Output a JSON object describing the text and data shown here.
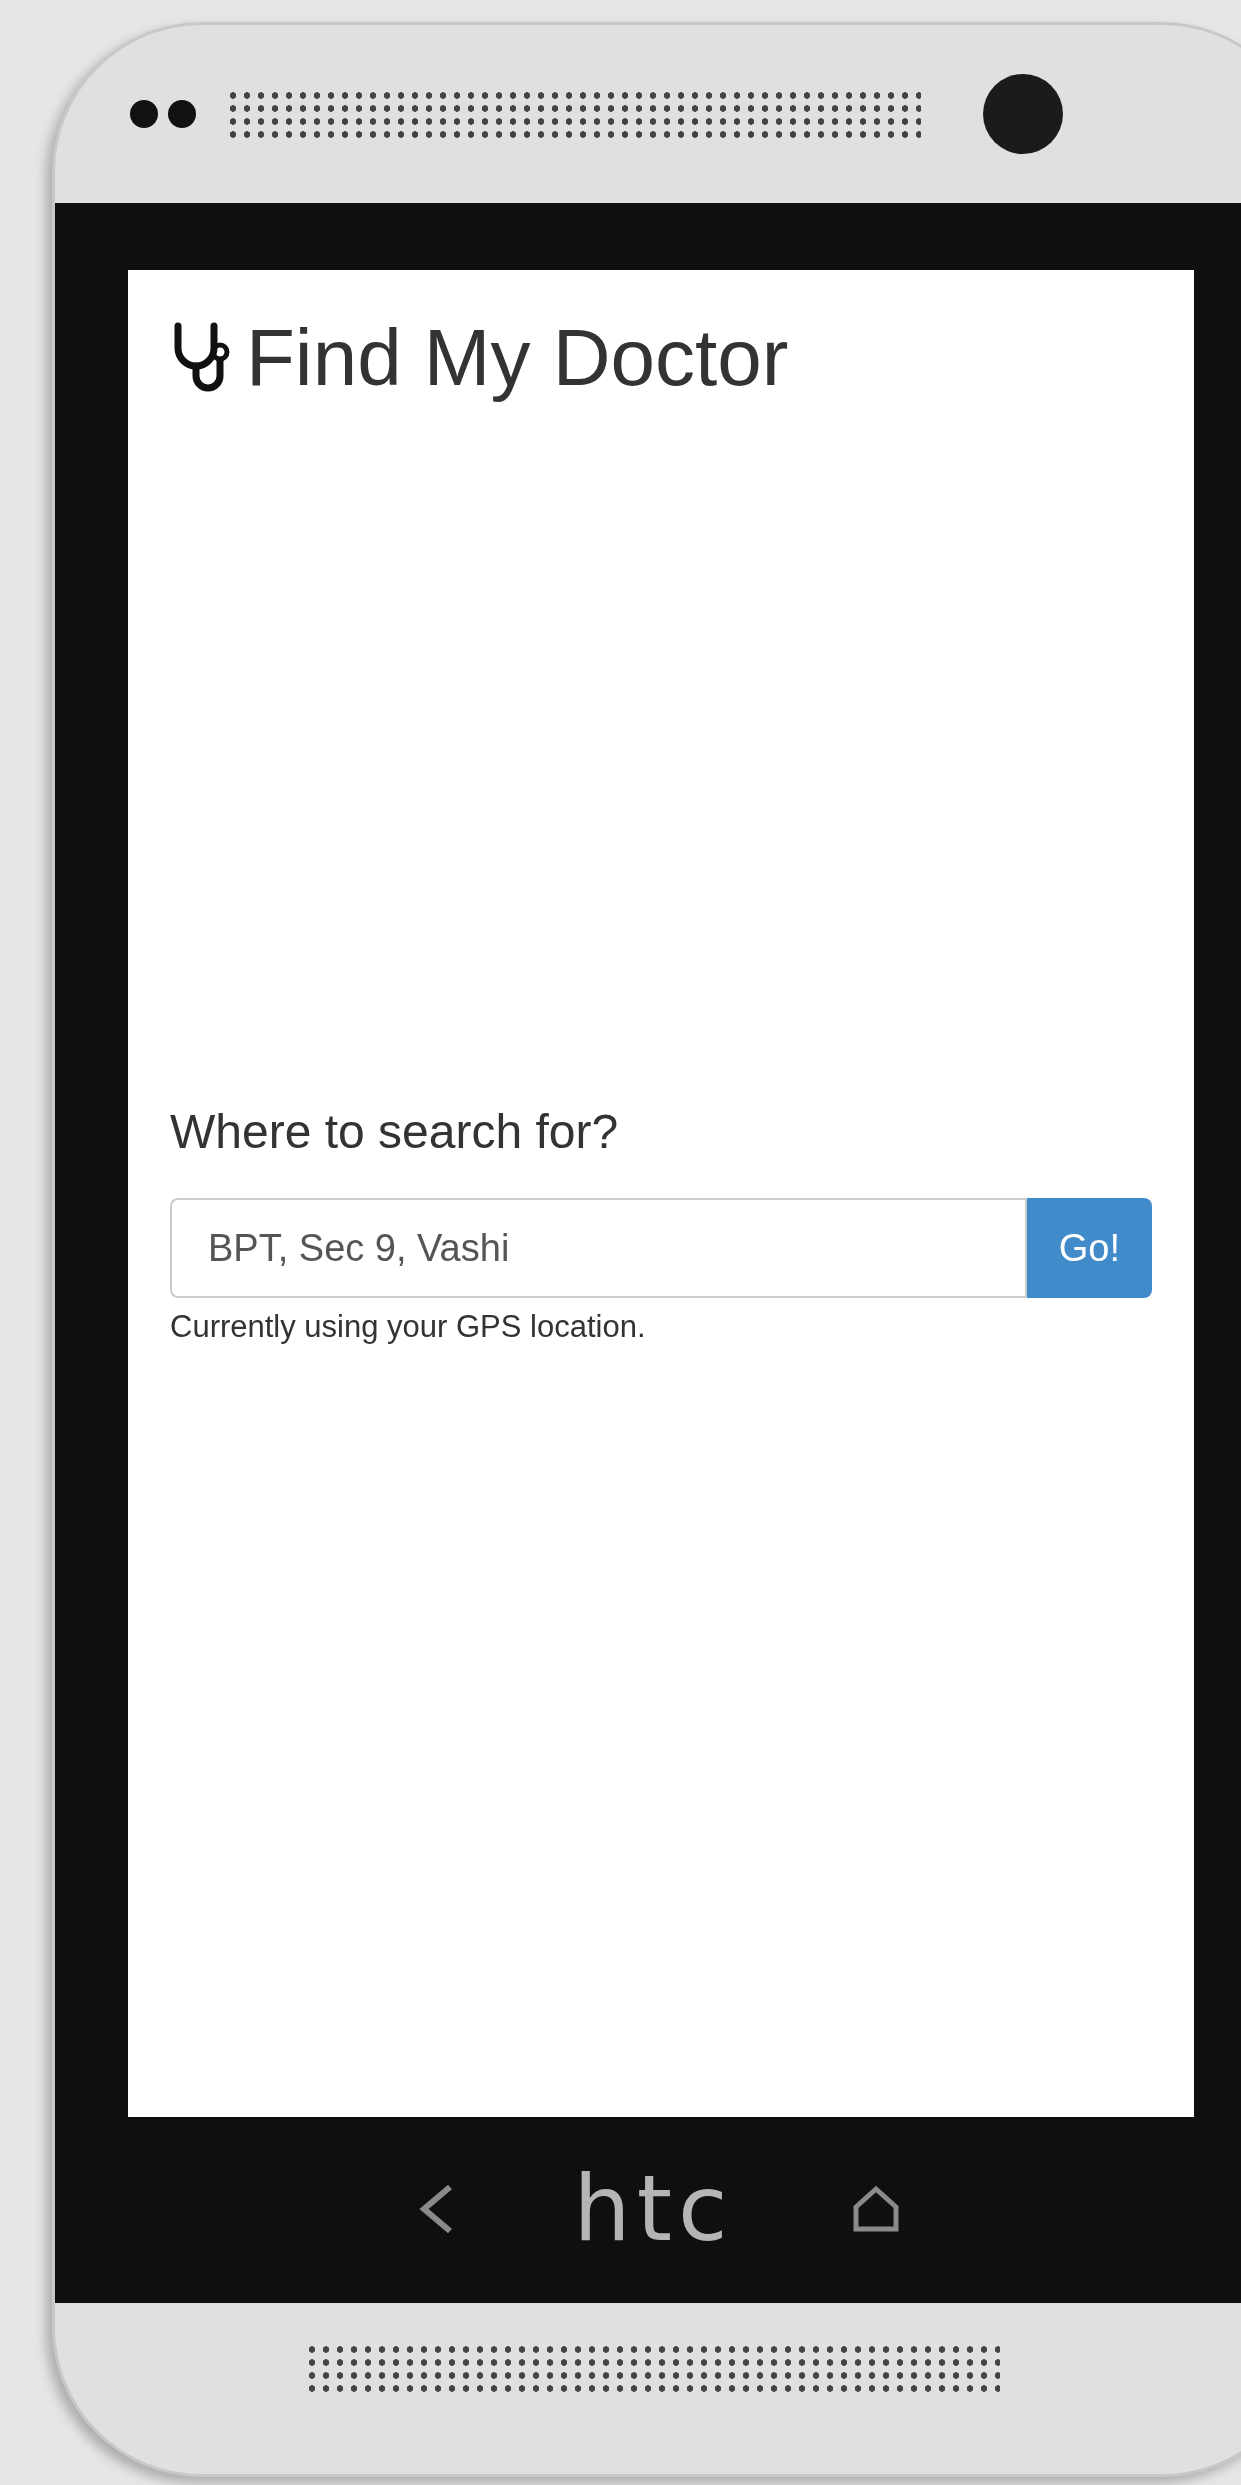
{
  "app": {
    "title": "Find My Doctor"
  },
  "search": {
    "label": "Where to search for?",
    "value": "BPT, Sec 9, Vashi",
    "button": "Go!",
    "help": "Currently using your GPS location."
  },
  "device": {
    "brand": "htc"
  }
}
